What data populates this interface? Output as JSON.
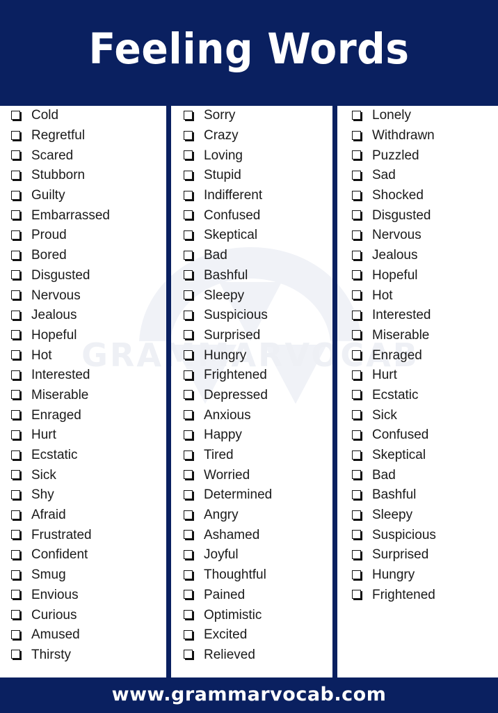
{
  "header": {
    "title": "Feeling Words",
    "background_color": "#0a2060",
    "text_color": "#ffffff"
  },
  "watermark": {
    "text": "GRAMMARVOCAB",
    "color": "#eef0f5"
  },
  "columns": [
    {
      "id": "column-1",
      "items": [
        "Cold",
        "Regretful",
        "Scared",
        "Stubborn",
        "Guilty",
        "Embarrassed",
        "Proud",
        "Bored",
        "Disgusted",
        "Nervous",
        "Jealous",
        "Hopeful",
        "Hot",
        "Interested",
        "Miserable",
        "Enraged",
        "Hurt",
        "Ecstatic",
        "Sick",
        "Shy",
        "Afraid",
        "Frustrated",
        "Confident",
        "Smug",
        "Envious",
        "Curious",
        "Amused",
        "Thirsty"
      ]
    },
    {
      "id": "column-2",
      "items": [
        "Sorry",
        "Crazy",
        "Loving",
        "Stupid",
        "Indifferent",
        "Confused",
        "Skeptical",
        "Bad",
        "Bashful",
        "Sleepy",
        "Suspicious",
        "Surprised",
        "Hungry",
        "Frightened",
        "Depressed",
        "Anxious",
        "Happy",
        "Tired",
        "Worried",
        "Determined",
        "Angry",
        "Ashamed",
        "Joyful",
        "Thoughtful",
        "Pained",
        "Optimistic",
        "Excited",
        "Relieved"
      ]
    },
    {
      "id": "column-3",
      "items": [
        "Lonely",
        "Withdrawn",
        "Puzzled",
        "Sad",
        "Shocked",
        "Disgusted",
        "Nervous",
        "Jealous",
        "Hopeful",
        "Hot",
        "Interested",
        "Miserable",
        "Enraged",
        "Hurt",
        "Ecstatic",
        "Sick",
        "Confused",
        "Skeptical",
        "Bad",
        "Bashful",
        "Sleepy",
        "Suspicious",
        "Surprised",
        "Hungry",
        "Frightened"
      ]
    }
  ],
  "footer": {
    "url": "www.grammarvocab.com",
    "background_color": "#0a2060",
    "text_color": "#ffffff"
  },
  "icons": {
    "checkbox": "checkbox-icon"
  }
}
